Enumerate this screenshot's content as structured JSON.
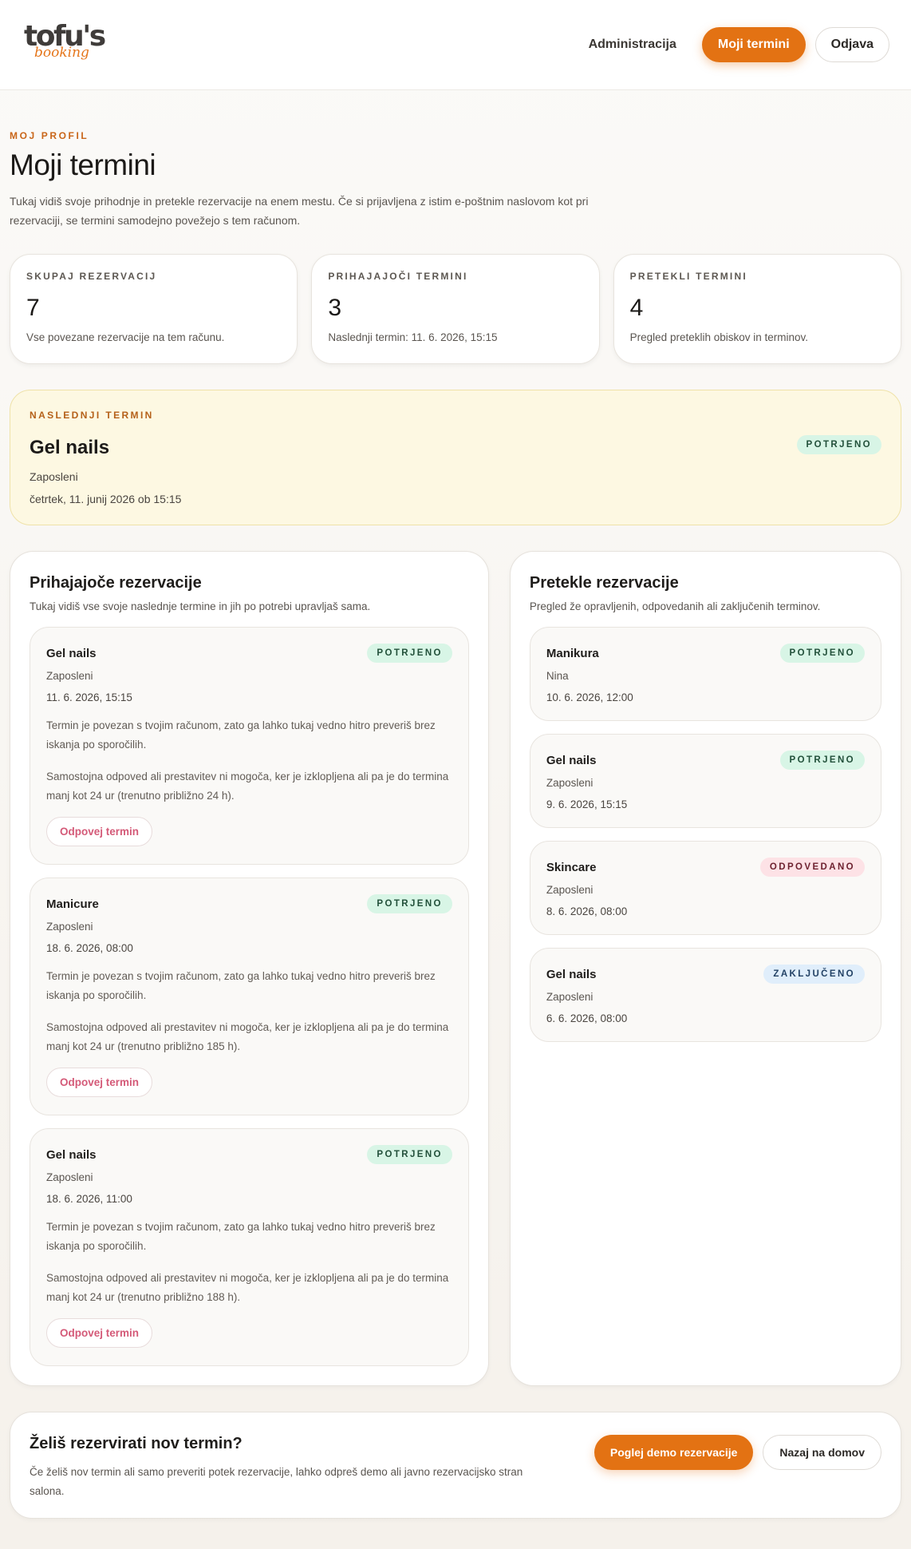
{
  "header": {
    "logo_text": "tofu's",
    "logo_sub": "booking",
    "nav": {
      "admin": "Administracija",
      "my_appointments": "Moji termini",
      "logout": "Odjava"
    }
  },
  "intro": {
    "eyebrow": "MOJ PROFIL",
    "title": "Moji termini",
    "lead": "Tukaj vidiš svoje prihodnje in pretekle rezervacije na enem mestu. Če si prijavljena z istim e-poštnim naslovom kot pri rezervaciji, se termini samodejno povežejo s tem računom."
  },
  "stats": [
    {
      "label": "SKUPAJ REZERVACIJ",
      "value": "7",
      "desc": "Vse povezane rezervacije na tem računu."
    },
    {
      "label": "PRIHAJAJOČI TERMINI",
      "value": "3",
      "desc": "Naslednji termin: 11. 6. 2026, 15:15"
    },
    {
      "label": "PRETEKLI TERMINI",
      "value": "4",
      "desc": "Pregled preteklih obiskov in terminov."
    }
  ],
  "next": {
    "eyebrow": "NASLEDNJI TERMIN",
    "title": "Gel nails",
    "staff": "Zaposleni",
    "datetime": "četrtek, 11. junij 2026 ob 15:15",
    "status": "POTRJENO"
  },
  "upcoming": {
    "title": "Prihajajoče rezervacije",
    "desc": "Tukaj vidiš vse svoje naslednje termine in jih po potrebi upravljaš sama.",
    "items": [
      {
        "service": "Gel nails",
        "staff": "Zaposleni",
        "date": "11. 6. 2026, 15:15",
        "status": "POTRJENO",
        "note1": "Termin je povezan s tvojim računom, zato ga lahko tukaj vedno hitro preveriš brez iskanja po sporočilih.",
        "note2": "Samostojna odpoved ali prestavitev ni mogoča, ker je izklopljena ali pa je do termina manj kot 24 ur (trenutno približno 24 h).",
        "action": "Odpovej termin"
      },
      {
        "service": "Manicure",
        "staff": "Zaposleni",
        "date": "18. 6. 2026, 08:00",
        "status": "POTRJENO",
        "note1": "Termin je povezan s tvojim računom, zato ga lahko tukaj vedno hitro preveriš brez iskanja po sporočilih.",
        "note2": "Samostojna odpoved ali prestavitev ni mogoča, ker je izklopljena ali pa je do termina manj kot 24 ur (trenutno približno 185 h).",
        "action": "Odpovej termin"
      },
      {
        "service": "Gel nails",
        "staff": "Zaposleni",
        "date": "18. 6. 2026, 11:00",
        "status": "POTRJENO",
        "note1": "Termin je povezan s tvojim računom, zato ga lahko tukaj vedno hitro preveriš brez iskanja po sporočilih.",
        "note2": "Samostojna odpoved ali prestavitev ni mogoča, ker je izklopljena ali pa je do termina manj kot 24 ur (trenutno približno 188 h).",
        "action": "Odpovej termin"
      }
    ]
  },
  "past": {
    "title": "Pretekle rezervacije",
    "desc": "Pregled že opravljenih, odpovedanih ali zaključenih terminov.",
    "items": [
      {
        "service": "Manikura",
        "staff": "Nina",
        "date": "10. 6. 2026, 12:00",
        "status": "POTRJENO"
      },
      {
        "service": "Gel nails",
        "staff": "Zaposleni",
        "date": "9. 6. 2026, 15:15",
        "status": "POTRJENO"
      },
      {
        "service": "Skincare",
        "staff": "Zaposleni",
        "date": "8. 6. 2026, 08:00",
        "status": "ODPOVEDANO"
      },
      {
        "service": "Gel nails",
        "staff": "Zaposleni",
        "date": "6. 6. 2026, 08:00",
        "status": "ZAKLJUČENO"
      }
    ]
  },
  "cta": {
    "title": "Želiš rezervirati nov termin?",
    "desc": "Če želiš nov termin ali samo preveriti potek rezervacije, lahko odpreš demo ali javno rezervacijsko stran salona.",
    "primary": "Poglej demo rezervacije",
    "secondary": "Nazaj na domov"
  },
  "colors": {
    "accent": "#e37213",
    "confirmed_bg": "#d8f5e6",
    "cancelled_bg": "#fde2e6",
    "completed_bg": "#e0eefb",
    "next_card_bg": "#fdf8e2"
  }
}
